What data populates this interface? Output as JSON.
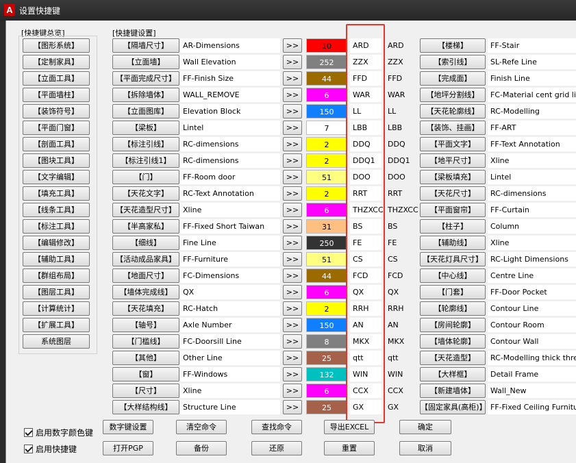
{
  "window": {
    "title": "设置快捷键",
    "app_icon_letter": "A"
  },
  "groups": {
    "overview": "[快捷键总览]",
    "settings": "[快捷键设置]"
  },
  "categories": [
    "【图形系统】",
    "【定制家具】",
    "【立面工具】",
    "【平面墙柱】",
    "【装饰符号】",
    "【平面门窗】",
    "【剖面工具】",
    "【图块工具】",
    "【文字编辑】",
    "【填充工具】",
    "【线条工具】",
    "【标注工具】",
    "【编辑修改】",
    "【辅助工具】",
    "【群组布局】",
    "【图层工具】",
    "【计算统计】",
    "【扩展工具】",
    "系统图层"
  ],
  "arrow_label": ">>",
  "rows": [
    {
      "name": "【隔墙尺寸】",
      "desc": "AR-Dimensions",
      "color": "#ff0000",
      "text": "#000",
      "num": "10",
      "cmd": "ARD",
      "cur": "ARD",
      "name2": "【楼梯】",
      "desc2": "FF-Stair"
    },
    {
      "name": "【立面墙】",
      "desc": "Wall Elevation",
      "color": "#808080",
      "text": "#fff",
      "num": "252",
      "cmd": "ZZX",
      "cur": "ZZX",
      "name2": "【索引线】",
      "desc2": "SL-Refe Line"
    },
    {
      "name": "【平面完成尺寸】",
      "desc": "FF-Finish Size",
      "color": "#9c6b00",
      "text": "#fff",
      "num": "44",
      "cmd": "FFD",
      "cur": "FFD",
      "name2": "【完成面】",
      "desc2": "Finish Line"
    },
    {
      "name": "【拆除墙体】",
      "desc": "WALL_REMOVE",
      "color": "#ff00ff",
      "text": "#fff",
      "num": "6",
      "cmd": "WAR",
      "cur": "WAR",
      "name2": "【地坪分割线】",
      "desc2": "FC-Material cent grid lines"
    },
    {
      "name": "【立面图库】",
      "desc": "Elevation Block",
      "color": "#0f7fff",
      "text": "#fff",
      "num": "150",
      "cmd": "LL",
      "cur": "LL",
      "name2": "【天花轮廓线】",
      "desc2": "RC-Modelling"
    },
    {
      "name": "【梁板】",
      "desc": "Lintel",
      "color": "#ffffff",
      "text": "#000",
      "num": "7",
      "cmd": "LBB",
      "cur": "LBB",
      "name2": "【装饰、挂画】",
      "desc2": "FF-ART"
    },
    {
      "name": "【标注引线】",
      "desc": "RC-dimensions",
      "color": "#ffff00",
      "text": "#000",
      "num": "2",
      "cmd": "DDQ",
      "cur": "DDQ",
      "name2": "【平面文字】",
      "desc2": "FF-Text Annotation"
    },
    {
      "name": "【标注引线1】",
      "desc": "RC-dimensions",
      "color": "#ffff00",
      "text": "#000",
      "num": "2",
      "cmd": "DDQ1",
      "cur": "DDQ1",
      "name2": "【地平尺寸】",
      "desc2": "Xline"
    },
    {
      "name": "【门】",
      "desc": "FF-Room door",
      "color": "#ffff80",
      "text": "#000",
      "num": "51",
      "cmd": "DOO",
      "cur": "DOO",
      "name2": "【梁板填充】",
      "desc2": "Lintel"
    },
    {
      "name": "【天花文字】",
      "desc": "RC-Text Annotation",
      "color": "#ffff00",
      "text": "#000",
      "num": "2",
      "cmd": "RRT",
      "cur": "RRT",
      "name2": "【天花尺寸】",
      "desc2": "RC-dimensions"
    },
    {
      "name": "【天花造型尺寸】",
      "desc": "Xline",
      "color": "#ff00ff",
      "text": "#fff",
      "num": "6",
      "cmd": "THZXCC",
      "cur": "THZXCC",
      "name2": "【平面窗帘】",
      "desc2": "FF-Curtain"
    },
    {
      "name": "【半高家私】",
      "desc": "FF-Fixed Short Taiwan",
      "color": "#ffbf80",
      "text": "#000",
      "num": "31",
      "cmd": "BS",
      "cur": "BS",
      "name2": "【柱子】",
      "desc2": "Column"
    },
    {
      "name": "【细线】",
      "desc": "Fine Line",
      "color": "#333333",
      "text": "#fff",
      "num": "250",
      "cmd": "FE",
      "cur": "FE",
      "name2": "【辅助线】",
      "desc2": "Xline"
    },
    {
      "name": "【活动成品家具】",
      "desc": "FF-Furniture",
      "color": "#ffff80",
      "text": "#000",
      "num": "51",
      "cmd": "CS",
      "cur": "CS",
      "name2": "【天花灯具尺寸】",
      "desc2": "RC-Light Dimensions"
    },
    {
      "name": "【地面尺寸】",
      "desc": "FC-Dimensions",
      "color": "#9c6b00",
      "text": "#fff",
      "num": "44",
      "cmd": "FCD",
      "cur": "FCD",
      "name2": "【中心线】",
      "desc2": "Centre Line"
    },
    {
      "name": "【墙体完成线】",
      "desc": "QX",
      "color": "#ff00ff",
      "text": "#fff",
      "num": "6",
      "cmd": "QX",
      "cur": "QX",
      "name2": "【门套】",
      "desc2": "FF-Door Pocket"
    },
    {
      "name": "【天花填充】",
      "desc": "RC-Hatch",
      "color": "#ffff00",
      "text": "#000",
      "num": "2",
      "cmd": "RRH",
      "cur": "RRH",
      "name2": "【轮廓线】",
      "desc2": "Contour Line"
    },
    {
      "name": "【轴号】",
      "desc": "Axle Number",
      "color": "#0f7fff",
      "text": "#fff",
      "num": "150",
      "cmd": "AN",
      "cur": "AN",
      "name2": "【房间轮廓】",
      "desc2": "Contour Room"
    },
    {
      "name": "【门槛线】",
      "desc": "FC-Doorsill Line",
      "color": "#808080",
      "text": "#fff",
      "num": "8",
      "cmd": "MKX",
      "cur": "MKX",
      "name2": "【墙体轮廓】",
      "desc2": "Contour Wall"
    },
    {
      "name": "【其他】",
      "desc": "Other Line",
      "color": "#a5614a",
      "text": "#fff",
      "num": "25",
      "cmd": "qtt",
      "cur": "qtt",
      "name2": "【天花造型】",
      "desc2": "RC-Modelling thick thread"
    },
    {
      "name": "【窗】",
      "desc": "FF-Windows",
      "color": "#00c0c0",
      "text": "#fff",
      "num": "132",
      "cmd": "WIN",
      "cur": "WIN",
      "name2": "【大样框】",
      "desc2": "Detail Frame"
    },
    {
      "name": "【尺寸】",
      "desc": "Xline",
      "color": "#ff00ff",
      "text": "#fff",
      "num": "6",
      "cmd": "CCX",
      "cur": "CCX",
      "name2": "【新建墙体】",
      "desc2": "Wall_New"
    },
    {
      "name": "【大样结构线】",
      "desc": "Structure Line",
      "color": "#a5614a",
      "text": "#fff",
      "num": "25",
      "cmd": "GX",
      "cur": "GX",
      "name2": "【固定家具(高柜)】",
      "desc2": "FF-Fixed Ceiling Furniture"
    }
  ],
  "bottom": {
    "chk_color": "启用数字颜色键",
    "chk_shortcut": "启用快捷键",
    "row1": [
      "数字键设置",
      "清空命令",
      "查找命令",
      "导出EXCEL",
      "确定"
    ],
    "row2": [
      "打开PGP",
      "备份",
      "还原",
      "重置",
      "取消"
    ]
  },
  "colors": {
    "highlight": "#e8352b",
    "titlebar": "#2b2b2b"
  }
}
